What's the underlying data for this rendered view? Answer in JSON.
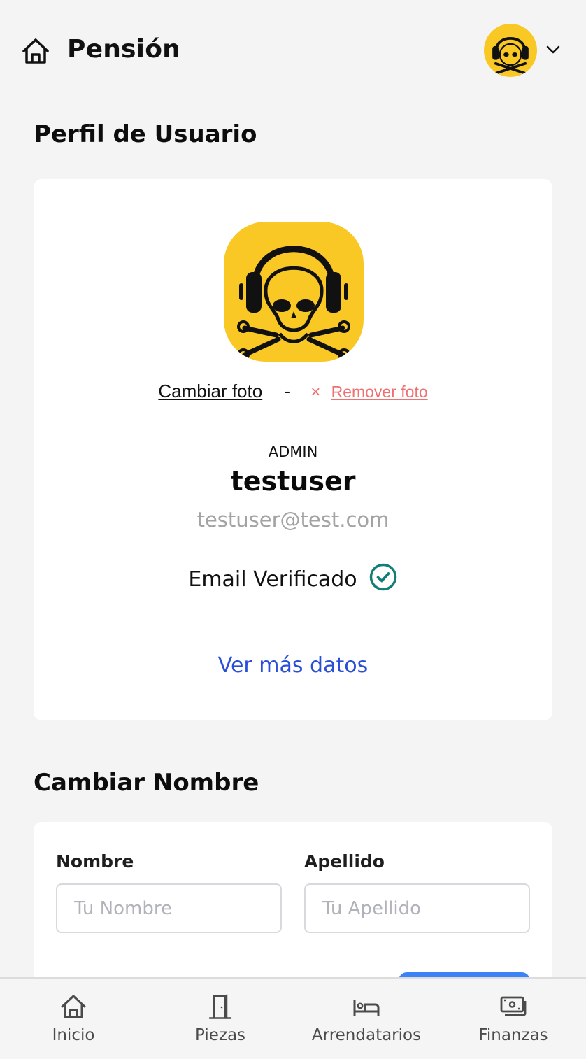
{
  "header": {
    "title": "Pensión",
    "home_icon": "home-icon",
    "avatar_icon": "skull-headphones-avatar",
    "menu_icon": "chevron-down-icon"
  },
  "profile": {
    "section_title": "Perfil de Usuario",
    "change_photo": "Cambiar foto",
    "separator": "-",
    "remove_icon": "×",
    "remove_photo": "Remover foto",
    "role": "ADMIN",
    "username": "testuser",
    "email": "testuser@test.com",
    "verified_label": "Email Verificado",
    "verified_icon": "check-circle-icon",
    "more_link": "Ver más datos"
  },
  "change_name": {
    "section_title": "Cambiar Nombre",
    "first_name": {
      "label": "Nombre",
      "value": "",
      "placeholder": "Tu Nombre"
    },
    "last_name": {
      "label": "Apellido",
      "value": "",
      "placeholder": "Tu Apellido"
    }
  },
  "nav": {
    "items": [
      {
        "label": "Inicio",
        "icon": "home-icon"
      },
      {
        "label": "Piezas",
        "icon": "door-icon"
      },
      {
        "label": "Arrendatarios",
        "icon": "bed-icon"
      },
      {
        "label": "Finanzas",
        "icon": "money-icon"
      }
    ]
  },
  "colors": {
    "background": "#f4f4f4",
    "avatar_bg": "#f9c825",
    "link_blue": "#2a4fd6",
    "remove_red": "#ef7070",
    "verified_teal": "#137e77",
    "primary_button": "#3b82f6"
  }
}
